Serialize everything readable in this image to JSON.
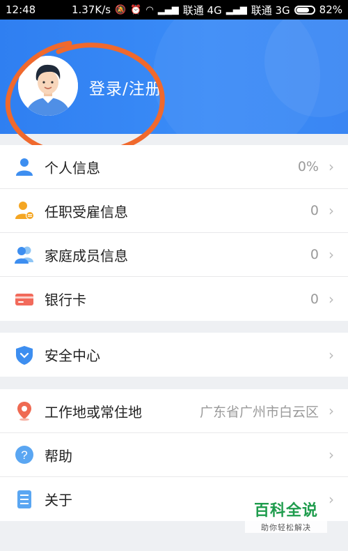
{
  "status_bar": {
    "time": "12:48",
    "speed": "1.37K/s",
    "carrier1": "联通 4G",
    "carrier2": "联通 3G",
    "battery": "82%",
    "battery_level": 0.82
  },
  "header": {
    "login_label": "登录/注册",
    "accent_color": "#3385f5"
  },
  "groups": [
    {
      "items": [
        {
          "label": "个人信息",
          "value": "0%",
          "icon": "person-icon"
        },
        {
          "label": "任职受雇信息",
          "value": "0",
          "icon": "employment-icon"
        },
        {
          "label": "家庭成员信息",
          "value": "0",
          "icon": "family-icon"
        },
        {
          "label": "银行卡",
          "value": "0",
          "icon": "bank-card-icon"
        }
      ]
    },
    {
      "items": [
        {
          "label": "安全中心",
          "value": "",
          "icon": "shield-icon"
        }
      ]
    },
    {
      "items": [
        {
          "label": "工作地或常住地",
          "value": "广东省广州市白云区",
          "icon": "location-pin-icon"
        },
        {
          "label": "帮助",
          "value": "",
          "icon": "help-icon"
        },
        {
          "label": "关于",
          "value": "",
          "icon": "document-icon"
        }
      ]
    }
  ],
  "watermark": {
    "title": "百科全说",
    "subtitle": "助你轻松解决"
  }
}
